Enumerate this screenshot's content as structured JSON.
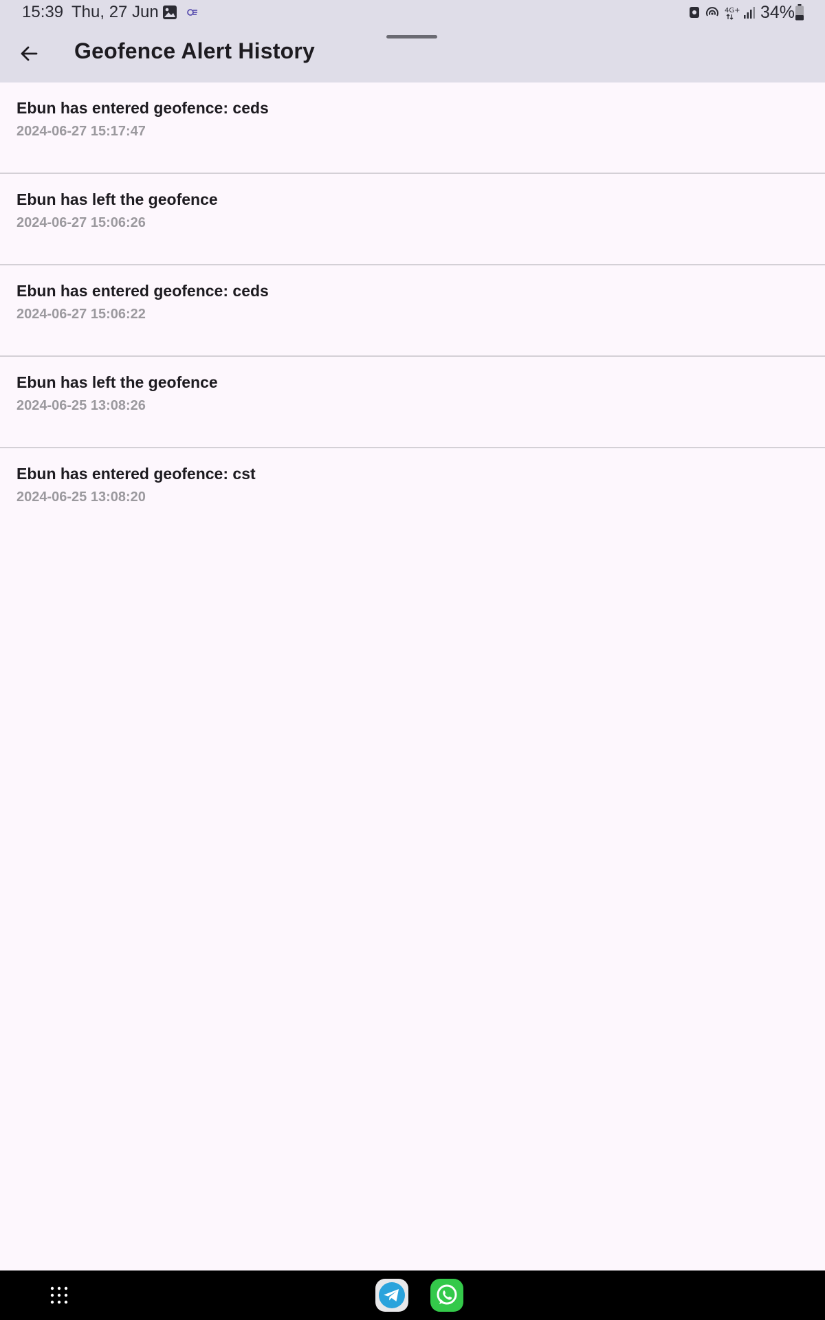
{
  "status_bar": {
    "time": "15:39",
    "date": "Thu, 27 Jun",
    "battery_percent": "34%",
    "network": "4G+",
    "left_icons": [
      "gallery-icon",
      "app-notification-icon"
    ],
    "right_icons": [
      "data-saver-icon",
      "hotspot-icon",
      "network-4g-icon",
      "signal-icon",
      "battery-icon"
    ]
  },
  "app_bar": {
    "title": "Geofence Alert History",
    "back_icon": "arrow-left-icon"
  },
  "alerts": [
    {
      "message": "Ebun has entered geofence: ceds",
      "timestamp": "2024-06-27 15:17:47"
    },
    {
      "message": "Ebun has left the geofence",
      "timestamp": "2024-06-27 15:06:26"
    },
    {
      "message": "Ebun has entered geofence: ceds",
      "timestamp": "2024-06-27 15:06:22"
    },
    {
      "message": "Ebun has left the geofence",
      "timestamp": "2024-06-25 13:08:26"
    },
    {
      "message": "Ebun has entered geofence: cst",
      "timestamp": "2024-06-25 13:08:20"
    }
  ],
  "nav_bar": {
    "apps_icon": "apps-grid-icon",
    "dock": [
      "telegram-icon",
      "whatsapp-icon"
    ]
  },
  "colors": {
    "app_bar_bg": "#dfdde8",
    "page_bg": "#fdf7fd",
    "divider": "#d4d0d6",
    "timestamp_text": "#9b999e",
    "telegram": "#2aa3dc",
    "whatsapp": "#34c94a"
  }
}
